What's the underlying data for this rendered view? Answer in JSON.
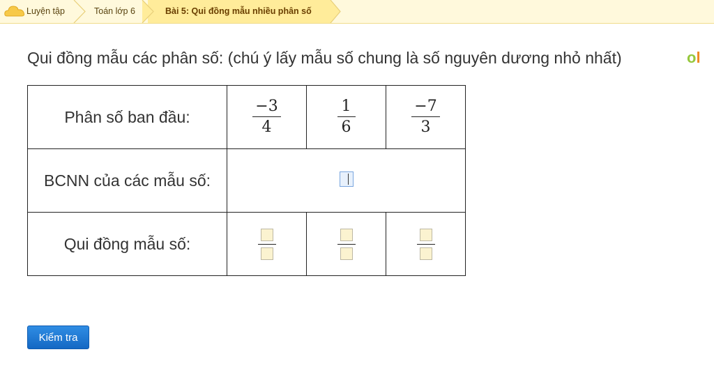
{
  "breadcrumb": {
    "items": [
      {
        "label": "Luyện tập"
      },
      {
        "label": "Toán lớp 6"
      },
      {
        "label": "Bài 5: Qui đồng mẫu nhiều phân số"
      }
    ]
  },
  "question": {
    "text": "Qui đồng mẫu các phân số: (chú ý lấy mẫu số chung là số nguyên dương nhỏ nhất)"
  },
  "logo": {
    "o": "o",
    "l": "l"
  },
  "table": {
    "row1_label": "Phân số ban đầu:",
    "row2_label": "BCNN của các mẫu số:",
    "row3_label": "Qui đồng mẫu số:",
    "fractions": [
      {
        "num": "−3",
        "den": "4"
      },
      {
        "num": "1",
        "den": "6"
      },
      {
        "num": "−7",
        "den": "3"
      }
    ],
    "lcm_value": "",
    "answers": [
      {
        "num": "",
        "den": ""
      },
      {
        "num": "",
        "den": ""
      },
      {
        "num": "",
        "den": ""
      }
    ]
  },
  "actions": {
    "check_label": "Kiểm tra"
  },
  "colors": {
    "accent": "#1a75d2",
    "crumb_bg": "#fff9dc",
    "crumb_active": "#ffec9a"
  }
}
